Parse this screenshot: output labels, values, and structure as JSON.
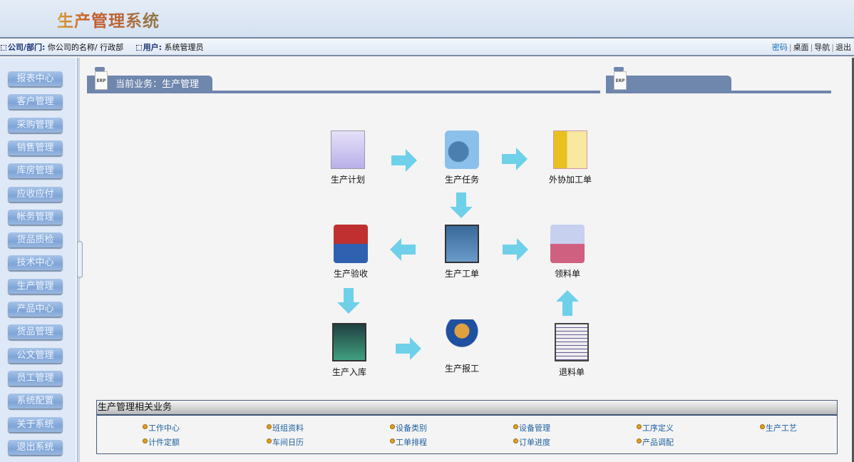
{
  "header": {
    "title": "生产管理系统"
  },
  "infobar": {
    "company_label": "公司/部门:",
    "company_value": "你公司的名称/ 行政部",
    "user_label": "用户:",
    "user_value": "系统管理员",
    "links": [
      "密码",
      "桌面",
      "导航",
      "退出"
    ]
  },
  "sidebar": {
    "items": [
      "报表中心",
      "客户管理",
      "采购管理",
      "销售管理",
      "库房管理",
      "应收应付",
      "帐务管理",
      "货品质检",
      "技术中心",
      "生产管理",
      "产品中心",
      "货品管理",
      "公文管理",
      "员工管理",
      "系统配置",
      "关于系统",
      "退出系统"
    ]
  },
  "main": {
    "current_tab": "当前业务：生产管理",
    "erp_label": "ERP",
    "flow": [
      {
        "label": "生产计划",
        "icon": "plan-chart-icon"
      },
      {
        "label": "生产任务",
        "icon": "task-gear-folder-icon"
      },
      {
        "label": "外协加工单",
        "icon": "outsourcing-coins-icon"
      },
      {
        "label": "生产验收",
        "icon": "acceptance-monitor-icon"
      },
      {
        "label": "生产工单",
        "icon": "work-order-icon"
      },
      {
        "label": "领料单",
        "icon": "material-cart-icon"
      },
      {
        "label": "生产入库",
        "icon": "warehouse-in-icon"
      },
      {
        "label": "生产报工",
        "icon": "worker-report-icon"
      },
      {
        "label": "退料单",
        "icon": "material-return-icon"
      }
    ],
    "related": {
      "title": "生产管理相关业务",
      "items": [
        "工作中心",
        "班组资料",
        "设备类别",
        "设备管理",
        "工序定义",
        "生产工艺",
        "计件定额",
        "车间日历",
        "工单排程",
        "订单进度",
        "产品调配"
      ]
    }
  },
  "colors": {
    "accent": "#6f86ad",
    "arrow": "#6fd0ea",
    "link": "#1f5fa0"
  }
}
